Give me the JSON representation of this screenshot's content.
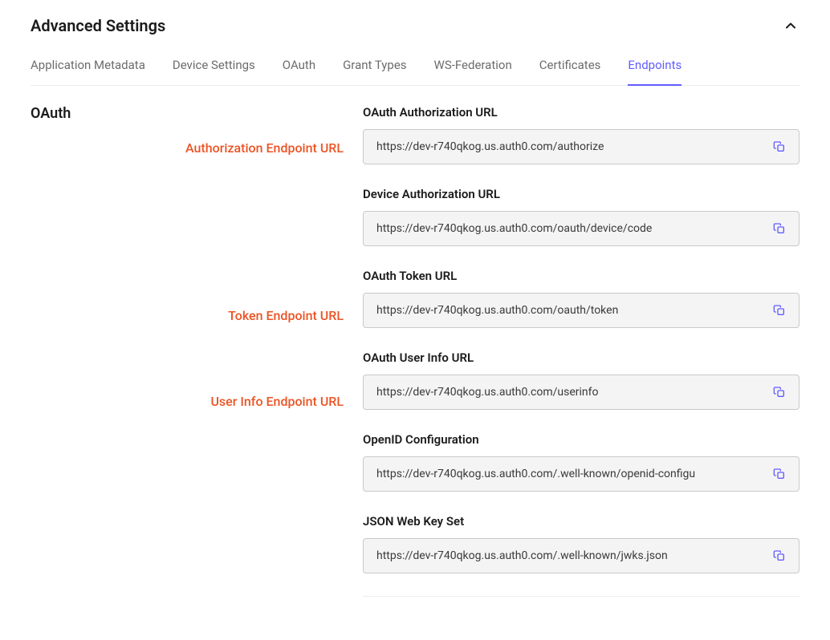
{
  "header": {
    "title": "Advanced Settings"
  },
  "tabs": [
    {
      "label": "Application Metadata",
      "active": false
    },
    {
      "label": "Device Settings",
      "active": false
    },
    {
      "label": "OAuth",
      "active": false
    },
    {
      "label": "Grant Types",
      "active": false
    },
    {
      "label": "WS-Federation",
      "active": false
    },
    {
      "label": "Certificates",
      "active": false
    },
    {
      "label": "Endpoints",
      "active": true
    }
  ],
  "section": {
    "title": "OAuth"
  },
  "annotations": {
    "authorization": "Authorization Endpoint URL",
    "token": "Token Endpoint URL",
    "userinfo": "User Info Endpoint URL"
  },
  "fields": [
    {
      "label": "OAuth Authorization URL",
      "value": "https://dev-r740qkog.us.auth0.com/authorize",
      "annotationKey": "authorization"
    },
    {
      "label": "Device Authorization URL",
      "value": "https://dev-r740qkog.us.auth0.com/oauth/device/code",
      "annotationKey": null
    },
    {
      "label": "OAuth Token URL",
      "value": "https://dev-r740qkog.us.auth0.com/oauth/token",
      "annotationKey": "token"
    },
    {
      "label": "OAuth User Info URL",
      "value": "https://dev-r740qkog.us.auth0.com/userinfo",
      "annotationKey": "userinfo"
    },
    {
      "label": "OpenID Configuration",
      "value": "https://dev-r740qkog.us.auth0.com/.well-known/openid-configu",
      "annotationKey": null
    },
    {
      "label": "JSON Web Key Set",
      "value": "https://dev-r740qkog.us.auth0.com/.well-known/jwks.json",
      "annotationKey": null
    }
  ],
  "colors": {
    "accent": "#635dff",
    "annotation": "#eb5424"
  }
}
